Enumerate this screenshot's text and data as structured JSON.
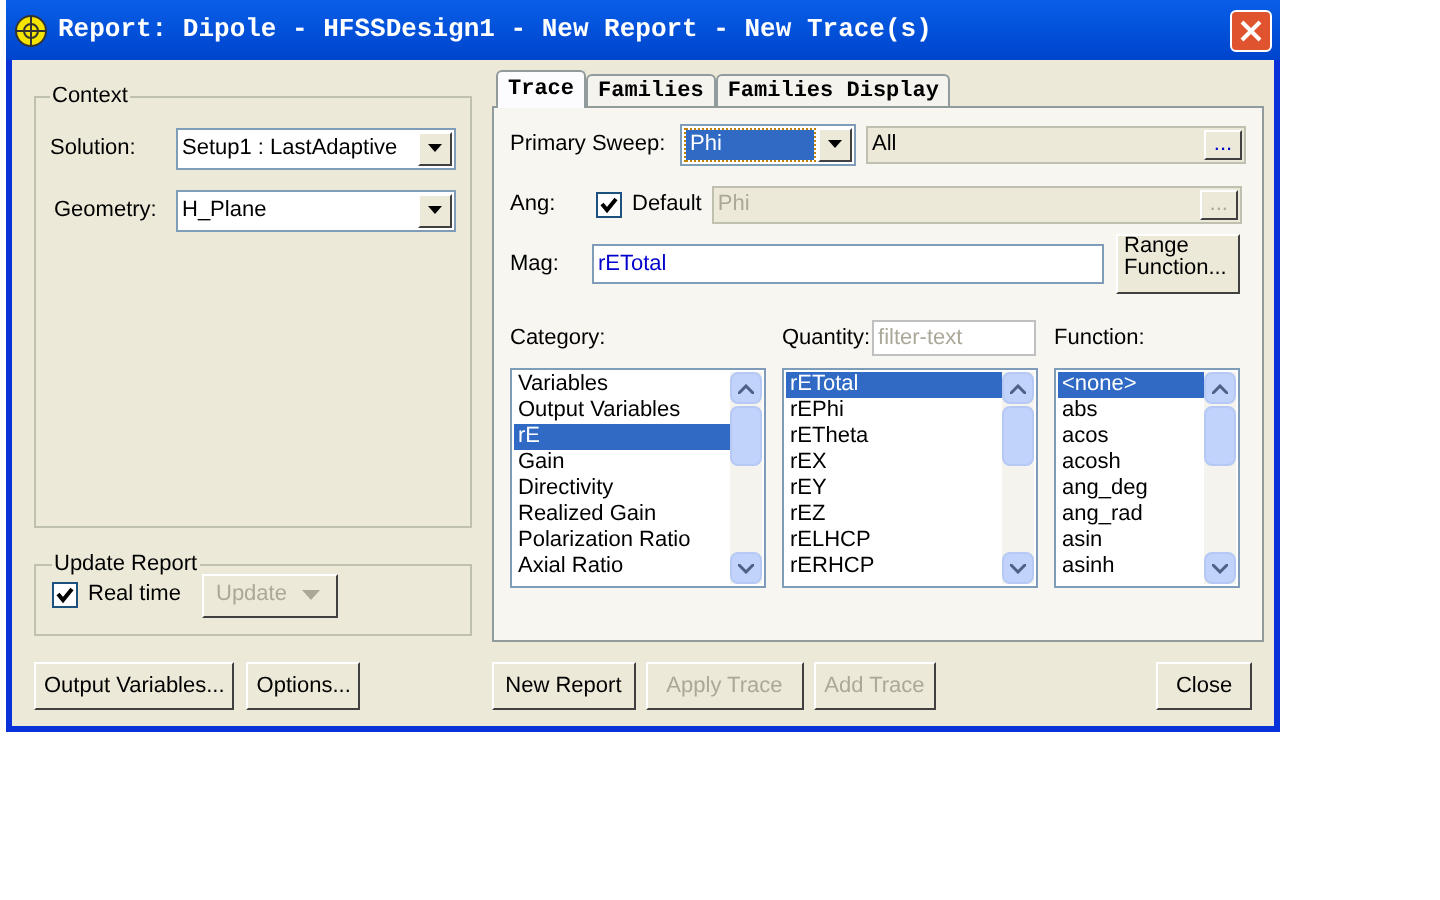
{
  "window": {
    "title": "Report: Dipole - HFSSDesign1 - New Report - New Trace(s)"
  },
  "context": {
    "title": "Context",
    "solution": {
      "label": "Solution:",
      "value": "Setup1 : LastAdaptive"
    },
    "geometry": {
      "label": "Geometry:",
      "value": "H_Plane"
    }
  },
  "update_report": {
    "title": "Update Report",
    "real_time": {
      "label": "Real time",
      "checked": true
    },
    "update_button": {
      "label": "Update",
      "disabled": true
    }
  },
  "tabs": [
    {
      "label": "Trace",
      "selected": true
    },
    {
      "label": "Families",
      "selected": false
    },
    {
      "label": "Families Display",
      "selected": false
    }
  ],
  "trace": {
    "primary_sweep": {
      "label": "Primary Sweep:",
      "value": "Phi",
      "range": "All",
      "browse": "..."
    },
    "ang": {
      "label": "Ang:",
      "default_label": "Default",
      "default_checked": true,
      "value": "Phi",
      "browse": "..."
    },
    "mag": {
      "label": "Mag:",
      "value": "rETotal"
    },
    "range_function": [
      "Range",
      "Function..."
    ],
    "lists": [
      {
        "label": "Category:",
        "items": [
          {
            "text": "Variables",
            "selected": false
          },
          {
            "text": "Output Variables",
            "selected": false
          },
          {
            "text": "rE",
            "selected": true
          },
          {
            "text": "Gain",
            "selected": false
          },
          {
            "text": "Directivity",
            "selected": false
          },
          {
            "text": "Realized Gain",
            "selected": false
          },
          {
            "text": "Polarization Ratio",
            "selected": false
          },
          {
            "text": "Axial Ratio",
            "selected": false
          }
        ]
      },
      {
        "label": "Quantity:",
        "filter_placeholder": "filter-text",
        "items": [
          {
            "text": "rETotal",
            "selected": true
          },
          {
            "text": "rEPhi",
            "selected": false
          },
          {
            "text": "rETheta",
            "selected": false
          },
          {
            "text": "rEX",
            "selected": false
          },
          {
            "text": "rEY",
            "selected": false
          },
          {
            "text": "rEZ",
            "selected": false
          },
          {
            "text": "rELHCP",
            "selected": false
          },
          {
            "text": "rERHCP",
            "selected": false
          }
        ]
      },
      {
        "label": "Function:",
        "items": [
          {
            "text": "<none>",
            "selected": true
          },
          {
            "text": "abs",
            "selected": false
          },
          {
            "text": "acos",
            "selected": false
          },
          {
            "text": "acosh",
            "selected": false
          },
          {
            "text": "ang_deg",
            "selected": false
          },
          {
            "text": "ang_rad",
            "selected": false
          },
          {
            "text": "asin",
            "selected": false
          },
          {
            "text": "asinh",
            "selected": false
          }
        ]
      }
    ]
  },
  "left_buttons": [
    {
      "label": "Output Variables...",
      "disabled": false
    },
    {
      "label": "Options...",
      "disabled": false
    }
  ],
  "right_buttons": [
    {
      "label": "New Report",
      "disabled": false
    },
    {
      "label": "Apply Trace",
      "disabled": true
    },
    {
      "label": "Add Trace",
      "disabled": true
    }
  ],
  "close_button": {
    "label": "Close"
  }
}
